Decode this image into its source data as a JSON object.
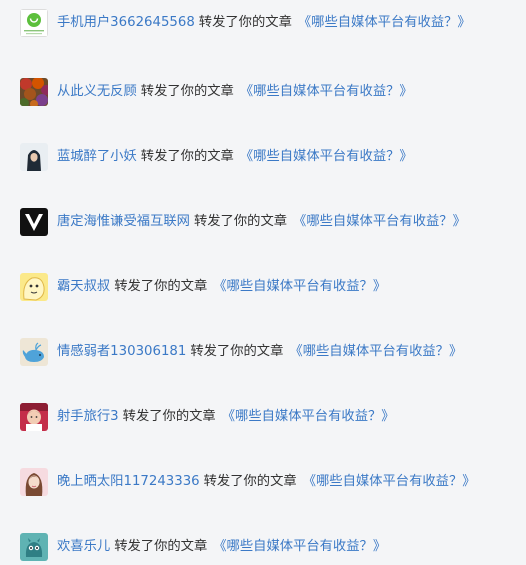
{
  "colors": {
    "background": "#f4f5f7",
    "link": "#3b79c6",
    "text": "#333333"
  },
  "notifications": [
    {
      "user": "手机用户3662645568",
      "action": "转发了你的文章",
      "article": "《哪些自媒体平台有收益？》",
      "avatar_icon": "green-phone-avatar-icon"
    },
    {
      "user": "从此义无反顾",
      "action": "转发了你的文章",
      "article": "《哪些自媒体平台有收益？》",
      "avatar_icon": "autumn-photo-avatar-icon"
    },
    {
      "user": "蓝城醉了小妖",
      "action": "转发了你的文章",
      "article": "《哪些自媒体平台有收益？》",
      "avatar_icon": "hooded-girl-avatar-icon"
    },
    {
      "user": "唐定海惟谦受福互联网",
      "action": "转发了你的文章",
      "article": "《哪些自媒体平台有收益？》",
      "avatar_icon": "v-logo-avatar-icon"
    },
    {
      "user": "霸天叔叔",
      "action": "转发了你的文章",
      "article": "《哪些自媒体平台有收益？》",
      "avatar_icon": "cartoon-face-avatar-icon"
    },
    {
      "user": "情感弱者130306181",
      "action": "转发了你的文章",
      "article": "《哪些自媒体平台有收益？》",
      "avatar_icon": "whale-avatar-icon"
    },
    {
      "user": "射手旅行3",
      "action": "转发了你的文章",
      "article": "《哪些自媒体平台有收益？》",
      "avatar_icon": "baby-photo-avatar-icon"
    },
    {
      "user": "晚上晒太阳117243336",
      "action": "转发了你的文章",
      "article": "《哪些自媒体平台有收益？》",
      "avatar_icon": "girl-portrait-avatar-icon"
    },
    {
      "user": "欢喜乐儿",
      "action": "转发了你的文章",
      "article": "《哪些自媒体平台有收益？》",
      "avatar_icon": "teal-creature-avatar-icon"
    }
  ]
}
